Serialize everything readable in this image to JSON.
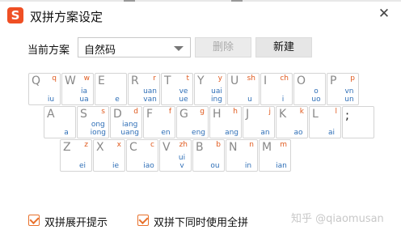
{
  "window": {
    "title": "双拼方案设定",
    "logo_text": "S",
    "close_glyph": "✕"
  },
  "scheme": {
    "label": "当前方案",
    "selected": "自然码",
    "delete_label": "删除",
    "new_label": "新建"
  },
  "keyboard": {
    "rows": [
      [
        {
          "letter": "Q",
          "initial": "q",
          "finals": [
            "iu"
          ]
        },
        {
          "letter": "W",
          "initial": "w",
          "finals": [
            "ia",
            "ua"
          ]
        },
        {
          "letter": "E",
          "initial": "",
          "finals": [
            "e"
          ]
        },
        {
          "letter": "R",
          "initial": "r",
          "finals": [
            "uan",
            "van"
          ]
        },
        {
          "letter": "T",
          "initial": "t",
          "finals": [
            "ve",
            "ue"
          ]
        },
        {
          "letter": "Y",
          "initial": "y",
          "finals": [
            "uai",
            "ing"
          ]
        },
        {
          "letter": "U",
          "initial": "sh",
          "finals": [
            "u"
          ]
        },
        {
          "letter": "I",
          "initial": "ch",
          "finals": [
            "i"
          ]
        },
        {
          "letter": "O",
          "initial": "",
          "finals": [
            "o",
            "uo"
          ]
        },
        {
          "letter": "P",
          "initial": "p",
          "finals": [
            "vn",
            "un"
          ]
        }
      ],
      [
        {
          "letter": "A",
          "initial": "",
          "finals": [
            "a"
          ]
        },
        {
          "letter": "S",
          "initial": "s",
          "finals": [
            "ong",
            "iong"
          ]
        },
        {
          "letter": "D",
          "initial": "d",
          "finals": [
            "iang",
            "uang"
          ]
        },
        {
          "letter": "F",
          "initial": "f",
          "finals": [
            "en"
          ]
        },
        {
          "letter": "G",
          "initial": "g",
          "finals": [
            "eng"
          ]
        },
        {
          "letter": "H",
          "initial": "h",
          "finals": [
            "ang"
          ]
        },
        {
          "letter": "J",
          "initial": "j",
          "finals": [
            "an"
          ]
        },
        {
          "letter": "K",
          "initial": "k",
          "finals": [
            "ao"
          ]
        },
        {
          "letter": "L",
          "initial": "l",
          "finals": [
            "ai"
          ]
        },
        {
          "letter": ";",
          "initial": "",
          "finals": []
        }
      ],
      [
        {
          "letter": "Z",
          "initial": "z",
          "finals": [
            "ei"
          ]
        },
        {
          "letter": "X",
          "initial": "x",
          "finals": [
            "ie"
          ]
        },
        {
          "letter": "C",
          "initial": "c",
          "finals": [
            "iao"
          ]
        },
        {
          "letter": "V",
          "initial": "zh",
          "finals": [
            "ui",
            "v"
          ]
        },
        {
          "letter": "B",
          "initial": "b",
          "finals": [
            "ou"
          ]
        },
        {
          "letter": "N",
          "initial": "n",
          "finals": [
            "in"
          ]
        },
        {
          "letter": "M",
          "initial": "m",
          "finals": [
            "ian"
          ]
        }
      ]
    ]
  },
  "options": {
    "expand_hint_label": "双拼展开提示",
    "fullpinyin_label": "双拼下同时使用全拼"
  },
  "watermark": "知乎 @qiaomusan",
  "colors": {
    "initial": "#e05a1e",
    "finals": "#2f6fb7",
    "brand": "#ef4f24",
    "checkbox": "#e8712c"
  }
}
